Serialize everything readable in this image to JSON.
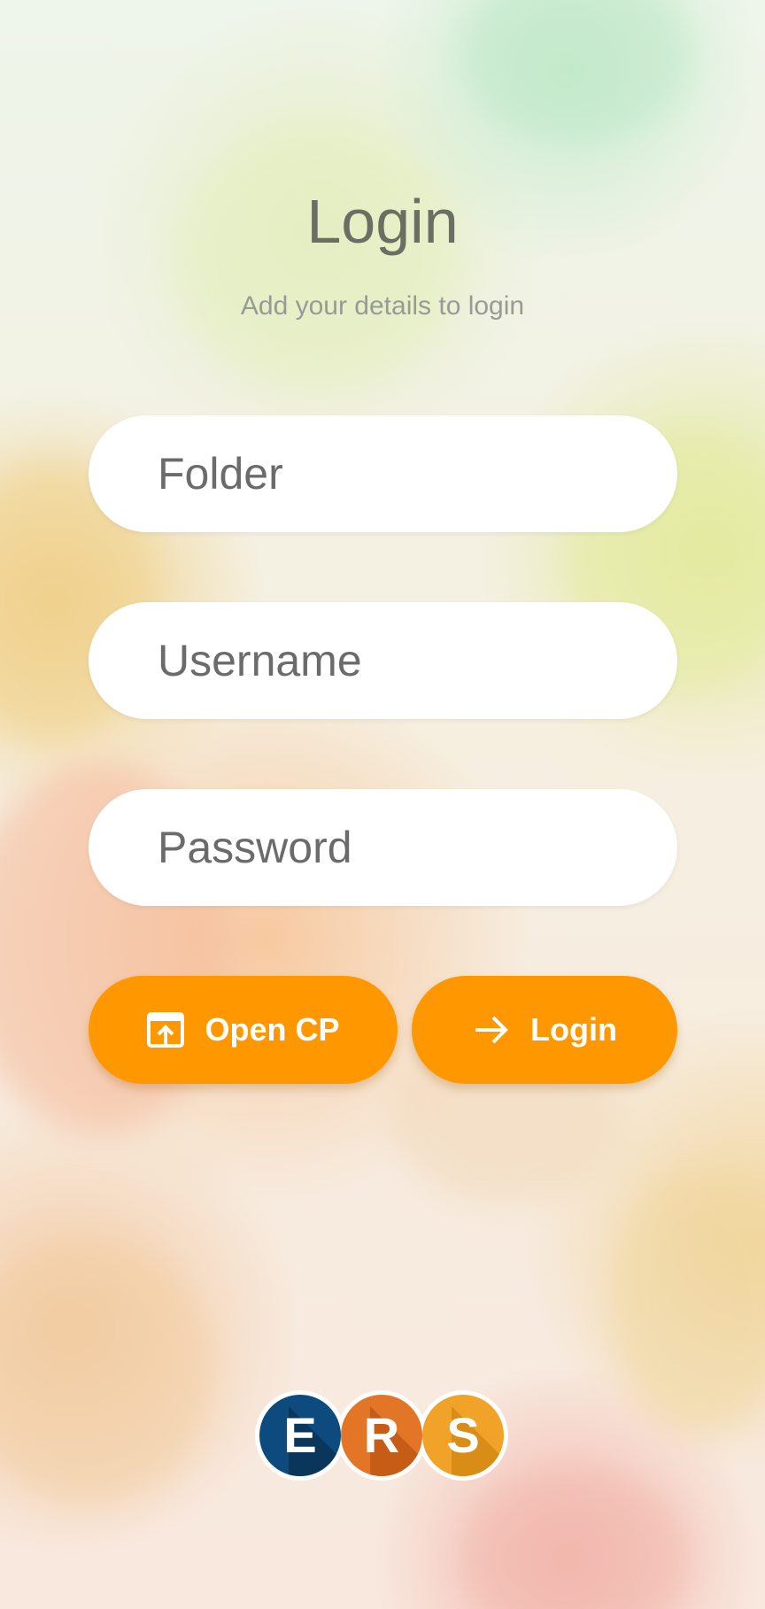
{
  "header": {
    "title": "Login",
    "subtitle": "Add your details to login"
  },
  "form": {
    "folder": {
      "placeholder": "Folder",
      "value": ""
    },
    "username": {
      "placeholder": "Username",
      "value": ""
    },
    "password": {
      "placeholder": "Password",
      "value": ""
    }
  },
  "actions": {
    "open_cp_label": "Open CP",
    "open_cp_icon": "open-in-browser-icon",
    "login_label": "Login",
    "login_icon": "arrow-right-icon"
  },
  "logo": {
    "letters": [
      "E",
      "R",
      "S"
    ],
    "colors": [
      "#0d4a7e",
      "#e37526",
      "#f0a328"
    ]
  },
  "colors": {
    "accent": "#ff9800",
    "title": "#6a6e63",
    "subtitle": "#9a9a94"
  }
}
